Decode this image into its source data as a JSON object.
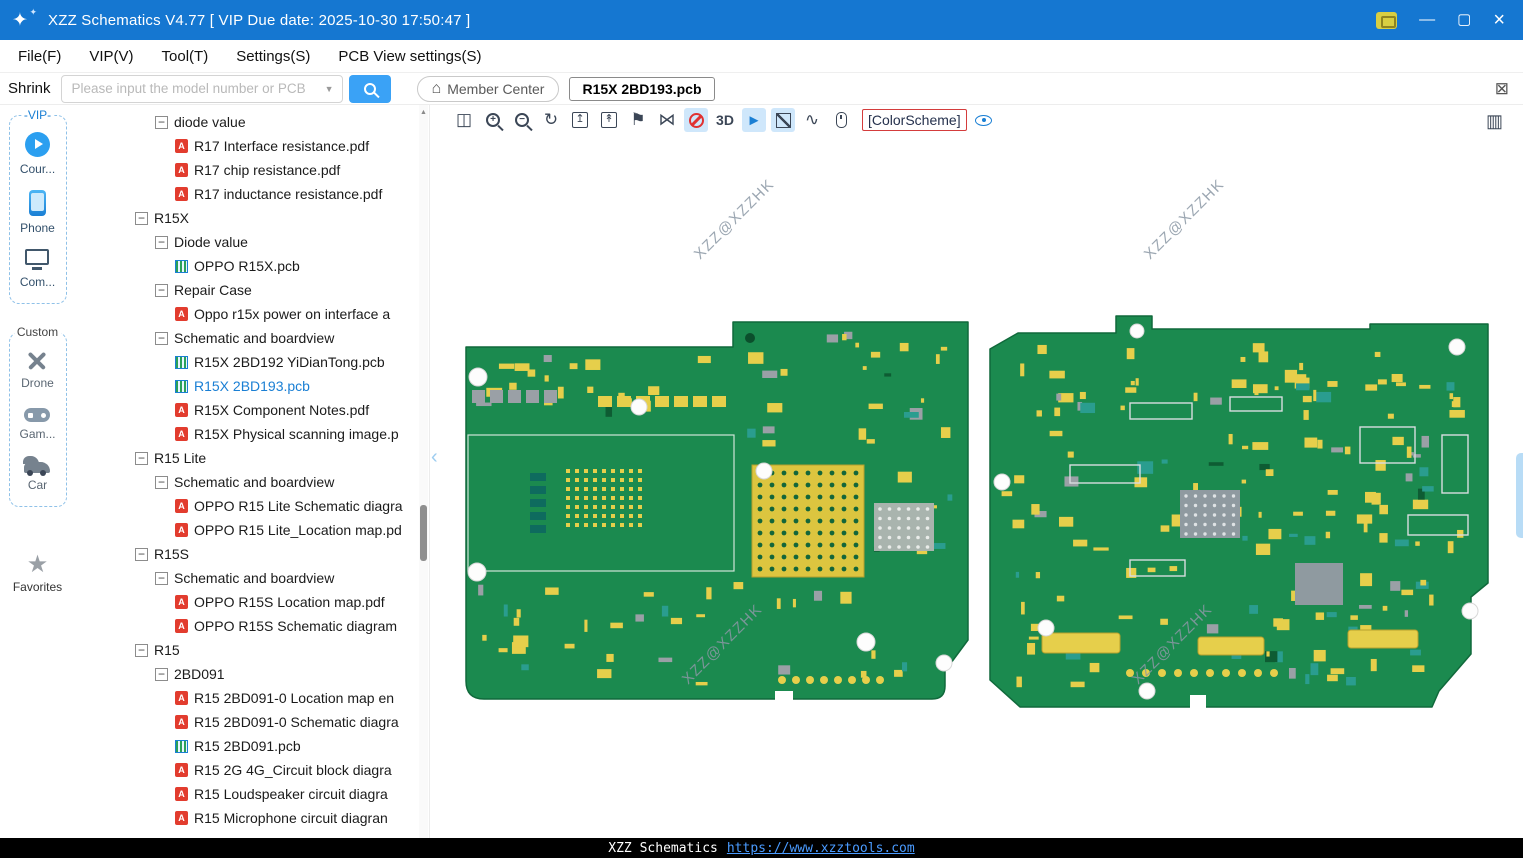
{
  "window": {
    "title": "XZZ Schematics V4.77 [ VIP Due date: 2025-10-30 17:50:47 ]"
  },
  "menu": {
    "items": [
      "File(F)",
      "VIP(V)",
      "Tool(T)",
      "Settings(S)",
      "PCB View settings(S)"
    ]
  },
  "toolbar": {
    "shrink_label": "Shrink",
    "search_placeholder": "Please input the model number or PCB",
    "member_center_label": "Member Center",
    "active_tab": "R15X 2BD193.pcb"
  },
  "sidebar": {
    "vip_label": "-VIP-",
    "custom_label": "Custom",
    "favorites_label": "Favorites",
    "vip_items": [
      {
        "label": "Cour...",
        "icon": "course-play-icon"
      },
      {
        "label": "Phone",
        "icon": "phone-icon"
      },
      {
        "label": "Com...",
        "icon": "computer-icon"
      }
    ],
    "custom_items": [
      {
        "label": "Drone",
        "icon": "drone-icon"
      },
      {
        "label": "Gam...",
        "icon": "gamepad-icon"
      },
      {
        "label": "Car",
        "icon": "car-icon"
      }
    ]
  },
  "tree": {
    "items": [
      {
        "label": "diode value",
        "type": "folder",
        "level": 2
      },
      {
        "label": "R17 Interface resistance.pdf",
        "type": "pdf",
        "level": 3
      },
      {
        "label": "R17 chip resistance.pdf",
        "type": "pdf",
        "level": 3
      },
      {
        "label": "R17 inductance resistance.pdf",
        "type": "pdf",
        "level": 3
      },
      {
        "label": "R15X",
        "type": "folder",
        "level": 1
      },
      {
        "label": "Diode value",
        "type": "folder",
        "level": 2
      },
      {
        "label": "OPPO R15X.pcb",
        "type": "pcb",
        "level": 3
      },
      {
        "label": "Repair Case",
        "type": "folder",
        "level": 2
      },
      {
        "label": "Oppo r15x power on interface a",
        "type": "pdf",
        "level": 3
      },
      {
        "label": "Schematic and boardview",
        "type": "folder",
        "level": 2
      },
      {
        "label": "R15X 2BD192 YiDianTong.pcb",
        "type": "pcb",
        "level": 3
      },
      {
        "label": "R15X 2BD193.pcb",
        "type": "pcb",
        "level": 3,
        "selected": true
      },
      {
        "label": "R15X Component Notes.pdf",
        "type": "pdf",
        "level": 3
      },
      {
        "label": "R15X Physical scanning image.p",
        "type": "pdf",
        "level": 3
      },
      {
        "label": "R15 Lite",
        "type": "folder",
        "level": 1
      },
      {
        "label": "Schematic and boardview",
        "type": "folder",
        "level": 2
      },
      {
        "label": "OPPO R15 Lite Schematic diagra",
        "type": "pdf",
        "level": 3
      },
      {
        "label": "OPPO R15 Lite_Location map.pd",
        "type": "pdf",
        "level": 3
      },
      {
        "label": "R15S",
        "type": "folder",
        "level": 1
      },
      {
        "label": "Schematic and boardview",
        "type": "folder",
        "level": 2
      },
      {
        "label": "OPPO R15S Location map.pdf",
        "type": "pdf",
        "level": 3
      },
      {
        "label": "OPPO R15S Schematic diagram",
        "type": "pdf",
        "level": 3
      },
      {
        "label": "R15",
        "type": "folder",
        "level": 1
      },
      {
        "label": "2BD091",
        "type": "folder",
        "level": 2
      },
      {
        "label": "R15 2BD091-0 Location map en",
        "type": "pdf",
        "level": 3
      },
      {
        "label": "R15 2BD091-0 Schematic diagra",
        "type": "pdf",
        "level": 3
      },
      {
        "label": "R15 2BD091.pcb",
        "type": "pcb",
        "level": 3
      },
      {
        "label": "R15 2G 4G_Circuit block diagra",
        "type": "pdf",
        "level": 3
      },
      {
        "label": "R15 Loudspeaker circuit diagra",
        "type": "pdf",
        "level": 3
      },
      {
        "label": "R15 Microphone circuit diagran",
        "type": "pdf",
        "level": 3
      }
    ]
  },
  "pcb_toolbar": {
    "three_d_label": "3D",
    "colorscheme_label": "[ColorScheme]",
    "icons": [
      {
        "name": "split-view-icon"
      },
      {
        "name": "zoom-in-icon"
      },
      {
        "name": "zoom-out-icon"
      },
      {
        "name": "zoom-refresh-icon"
      },
      {
        "name": "top-layer-icon"
      },
      {
        "name": "bottom-layer-icon"
      },
      {
        "name": "flag-icon"
      },
      {
        "name": "mirror-icon"
      },
      {
        "name": "disable-measure-icon",
        "selected": true
      },
      {
        "name": "three-d-button",
        "text": true
      },
      {
        "name": "arrow-tool-icon",
        "selected": true
      },
      {
        "name": "diagonal-measure-icon",
        "selected": true
      },
      {
        "name": "curve-icon"
      },
      {
        "name": "mouse-icon"
      },
      {
        "name": "colorscheme-button",
        "text": true
      },
      {
        "name": "eye-icon"
      }
    ]
  },
  "pcb_view": {
    "watermark": "XZZ@XZZHK"
  },
  "statusbar": {
    "brand": "XZZ Schematics",
    "url": "https://www.xzztools.com"
  },
  "colors": {
    "titlebar": "#1577d1",
    "accent_blue": "#1a7fd4",
    "board_green": "#1b8a4f",
    "component_yellow": "#e6cf4b",
    "pad_gray": "#9aa0a6",
    "teal": "#2a9d8f",
    "colorscheme_red": "#d43c3c",
    "status_link": "#4a9bff"
  }
}
